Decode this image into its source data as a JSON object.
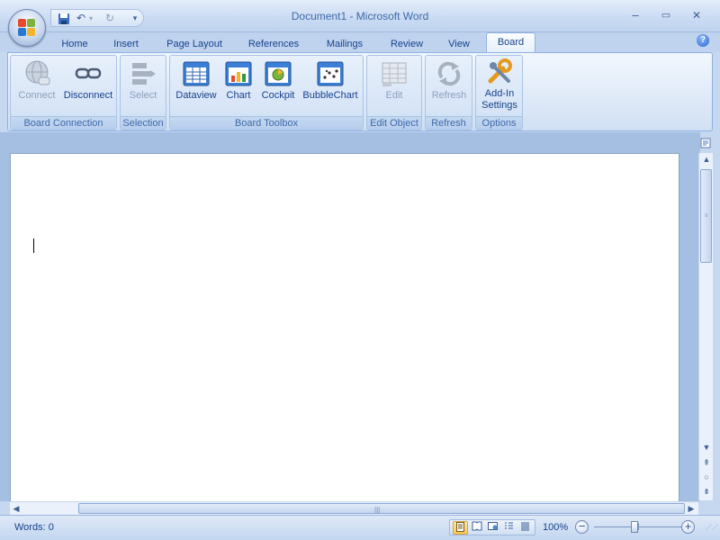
{
  "window": {
    "title": "Document1 - Microsoft Word",
    "min_label": "–",
    "max_label": "▭",
    "close_label": "✕"
  },
  "qat": {
    "save_icon": "save-icon",
    "undo_label": "↶",
    "undo_dd": "▾",
    "redo_label": "↻",
    "customize_label": "▾"
  },
  "tabs": [
    {
      "label": "Home"
    },
    {
      "label": "Insert"
    },
    {
      "label": "Page Layout"
    },
    {
      "label": "References"
    },
    {
      "label": "Mailings"
    },
    {
      "label": "Review"
    },
    {
      "label": "View"
    },
    {
      "label": "Board",
      "active": true
    }
  ],
  "help_label": "?",
  "ribbon": {
    "groups": {
      "board_connection": "Board Connection",
      "selection": "Selection",
      "board_toolbox": "Board Toolbox",
      "edit_object": "Edit Object",
      "refresh": "Refresh",
      "options": "Options"
    },
    "buttons": {
      "connect": {
        "label": "Connect",
        "enabled": false
      },
      "disconnect": {
        "label": "Disconnect",
        "enabled": true
      },
      "select": {
        "label": "Select",
        "enabled": false
      },
      "dataview": {
        "label": "Dataview",
        "enabled": true
      },
      "chart": {
        "label": "Chart",
        "enabled": true
      },
      "cockpit": {
        "label": "Cockpit",
        "enabled": true
      },
      "bubblechart": {
        "label": "BubbleChart",
        "enabled": true
      },
      "edit": {
        "label": "Edit",
        "enabled": false
      },
      "refresh": {
        "label": "Refresh",
        "enabled": false
      },
      "addin_line1": "Add-In",
      "addin_line2": "Settings"
    }
  },
  "document": {
    "ruler_icon": "ruler-toggle-icon"
  },
  "scrollbar": {
    "up": "▲",
    "down": "▼",
    "prev_page": "⇞",
    "browse_object": "○",
    "next_page": "⇟",
    "left": "◀",
    "right": "▶"
  },
  "statusbar": {
    "words": "Words: 0",
    "zoom": "100%",
    "zoom_out": "−",
    "zoom_in": "+"
  },
  "colors": {
    "accent": "#15428b",
    "ribbon_bg": "#dbe7f7",
    "frame": "#bfd3ef"
  }
}
